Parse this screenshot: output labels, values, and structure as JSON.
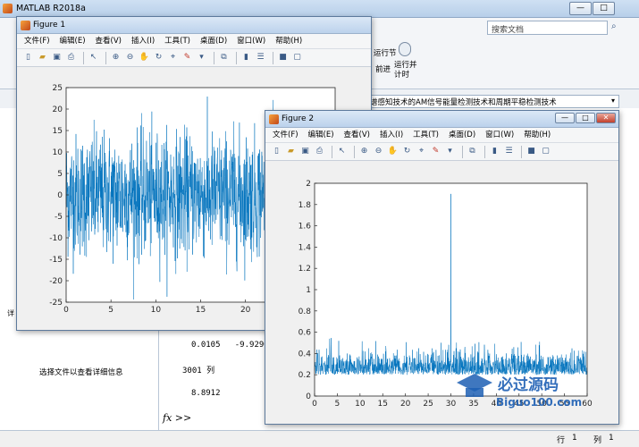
{
  "app": {
    "title": "MATLAB R2018a",
    "search_placeholder": "搜索文档",
    "ribbon_run_section": "运行节",
    "ribbon_advance": "前进",
    "ribbon_run_time": "运行并\n计时",
    "path": "谱感知技术的AM信号能量检测技术和周期平稳检测技术",
    "left_panel_hint": "选择文件以查看详细信息",
    "left_panel_tab": "详",
    "cmd_lines": [
      "0.0105   -9.9290",
      "3001 列",
      "8.8912"
    ],
    "cmd_prompt": "fx >>",
    "status_row_label": "行",
    "status_row": "1",
    "status_col_label": "列",
    "status_col": "1",
    "watermark": "Biguo100.com",
    "watermark_cn": "必过源码"
  },
  "figure1": {
    "title": "Figure 1",
    "menu": [
      "文件(F)",
      "编辑(E)",
      "查看(V)",
      "插入(I)",
      "工具(T)",
      "桌面(D)",
      "窗口(W)",
      "帮助(H)"
    ]
  },
  "figure2": {
    "title": "Figure 2",
    "menu": [
      "文件(F)",
      "编辑(E)",
      "查看(V)",
      "插入(I)",
      "工具(T)",
      "桌面(D)",
      "窗口(W)",
      "帮助(H)"
    ]
  },
  "chart_data": [
    {
      "type": "line",
      "title": "",
      "xlim": [
        0,
        30
      ],
      "ylim": [
        -25,
        25
      ],
      "xticks": [
        0,
        5,
        10,
        15,
        20
      ],
      "yticks": [
        -25,
        -20,
        -15,
        -10,
        -5,
        0,
        5,
        10,
        15,
        20,
        25
      ],
      "series_color": "#0072bd",
      "description_values": {
        "n_points": 3001,
        "noise_std": 7,
        "mean": 0
      }
    },
    {
      "type": "line",
      "title": "",
      "xlim": [
        0,
        60
      ],
      "ylim": [
        0,
        2
      ],
      "xticks": [
        0,
        5,
        10,
        15,
        20,
        25,
        30,
        35,
        40,
        45,
        50,
        55,
        60
      ],
      "yticks": [
        0,
        0.2,
        0.4,
        0.6,
        0.8,
        1,
        1.2,
        1.4,
        1.6,
        1.8,
        2
      ],
      "series_color": "#0072bd",
      "peak": {
        "x": 30,
        "y": 1.9
      }
    }
  ]
}
